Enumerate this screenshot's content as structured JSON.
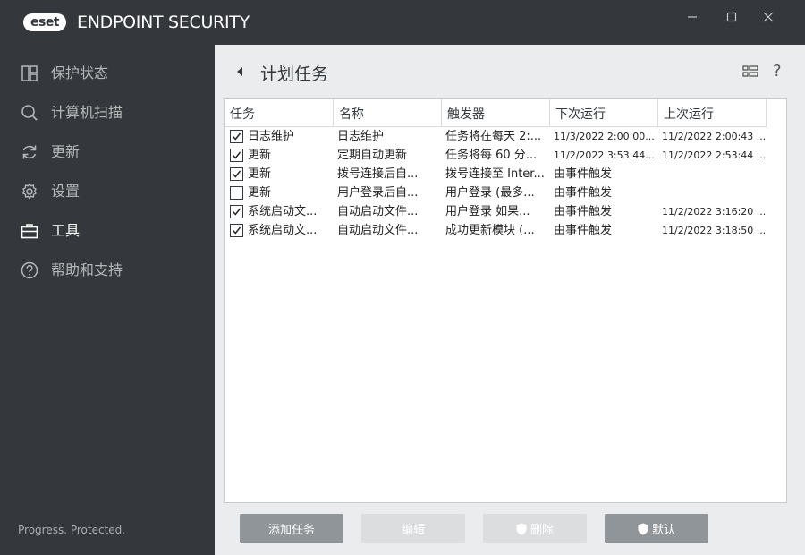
{
  "app": {
    "logo_badge": "eset",
    "logo_text": "ENDPOINT SECURITY"
  },
  "window": {
    "minimize_icon": "minimize-icon",
    "maximize_icon": "maximize-icon",
    "close_icon": "close-icon"
  },
  "sidebar": {
    "items": [
      {
        "label": "保护状态",
        "icon": "dashboard-icon",
        "active": false
      },
      {
        "label": "计算机扫描",
        "icon": "search-icon",
        "active": false
      },
      {
        "label": "更新",
        "icon": "refresh-icon",
        "active": false
      },
      {
        "label": "设置",
        "icon": "gear-icon",
        "active": false
      },
      {
        "label": "工具",
        "icon": "briefcase-icon",
        "active": true
      },
      {
        "label": "帮助和支持",
        "icon": "help-circle-icon",
        "active": false
      }
    ],
    "tagline": "Progress. Protected."
  },
  "main": {
    "title": "计划任务",
    "help": "?"
  },
  "table": {
    "columns": [
      "任务",
      "名称",
      "触发器",
      "下次运行",
      "上次运行"
    ],
    "rows": [
      {
        "checked": true,
        "task": "日志维护",
        "name": "日志维护",
        "trigger": "任务将在每天 2:...",
        "next": "11/3/2022 2:00:00...",
        "last": "11/2/2022 2:00:43 ..."
      },
      {
        "checked": true,
        "task": "更新",
        "name": "定期自动更新",
        "trigger": "任务将每 60 分...",
        "next": "11/2/2022 3:53:44...",
        "last": "11/2/2022 2:53:44 ..."
      },
      {
        "checked": true,
        "task": "更新",
        "name": "拨号连接后自...",
        "trigger": "拨号连接至 Inter...",
        "next": "由事件触发",
        "last": ""
      },
      {
        "checked": false,
        "task": "更新",
        "name": "用户登录后自...",
        "trigger": "用户登录 (最多...",
        "next": "由事件触发",
        "last": ""
      },
      {
        "checked": true,
        "task": "系统启动文...",
        "name": "自动启动文件...",
        "trigger": "用户登录 如果...",
        "next": "由事件触发",
        "last": "11/2/2022 3:16:20 ..."
      },
      {
        "checked": true,
        "task": "系统启动文...",
        "name": "自动启动文件...",
        "trigger": "成功更新模块 (...",
        "next": "由事件触发",
        "last": "11/2/2022 3:18:50 ..."
      }
    ]
  },
  "buttons": {
    "add": "添加任务",
    "edit": "编辑",
    "delete": "删除",
    "default": "默认"
  },
  "colors": {
    "sidebar_bg": "#34383c",
    "main_bg": "#ebeced",
    "button_enabled": "#909599",
    "button_disabled": "#dcdddf"
  }
}
